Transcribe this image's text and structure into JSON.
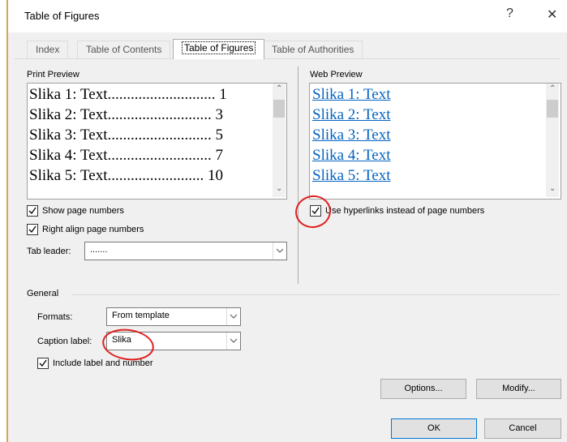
{
  "window": {
    "title": "Table of Figures",
    "help": "?",
    "close": "✕"
  },
  "tabs": [
    {
      "label": "Index"
    },
    {
      "label": "Table of Contents"
    },
    {
      "label": "Table of Figures"
    },
    {
      "label": "Table of Authorities"
    }
  ],
  "print_preview": {
    "label": "Print Preview",
    "lines": [
      {
        "text": "Slika 1: Text",
        "page": "1"
      },
      {
        "text": "Slika 2: Text",
        "page": "3"
      },
      {
        "text": "Slika 3: Text",
        "page": "5"
      },
      {
        "text": "Slika 4: Text",
        "page": "7"
      },
      {
        "text": "Slika 5: Text",
        "page": "10"
      }
    ],
    "show_page_numbers": {
      "label": "Show page numbers",
      "checked": true
    },
    "right_align": {
      "label": "Right align page numbers",
      "checked": true
    },
    "tab_leader": {
      "label": "Tab leader:",
      "value": "......."
    }
  },
  "web_preview": {
    "label": "Web Preview",
    "lines": [
      "Slika 1: Text",
      "Slika 2: Text",
      "Slika 3: Text",
      "Slika 4: Text",
      "Slika 5: Text"
    ],
    "use_hyperlinks": {
      "label": "Use hyperlinks instead of page numbers",
      "checked": true
    }
  },
  "general": {
    "label": "General",
    "formats": {
      "label": "Formats:",
      "value": "From template"
    },
    "caption_label": {
      "label": "Caption label:",
      "value": "Slika"
    },
    "include_label": {
      "label": "Include label and number",
      "checked": true
    }
  },
  "buttons": {
    "options": "Options...",
    "modify": "Modify...",
    "ok": "OK",
    "cancel": "Cancel"
  },
  "colors": {
    "link": "#0563c1",
    "annotation": "#e02020"
  }
}
